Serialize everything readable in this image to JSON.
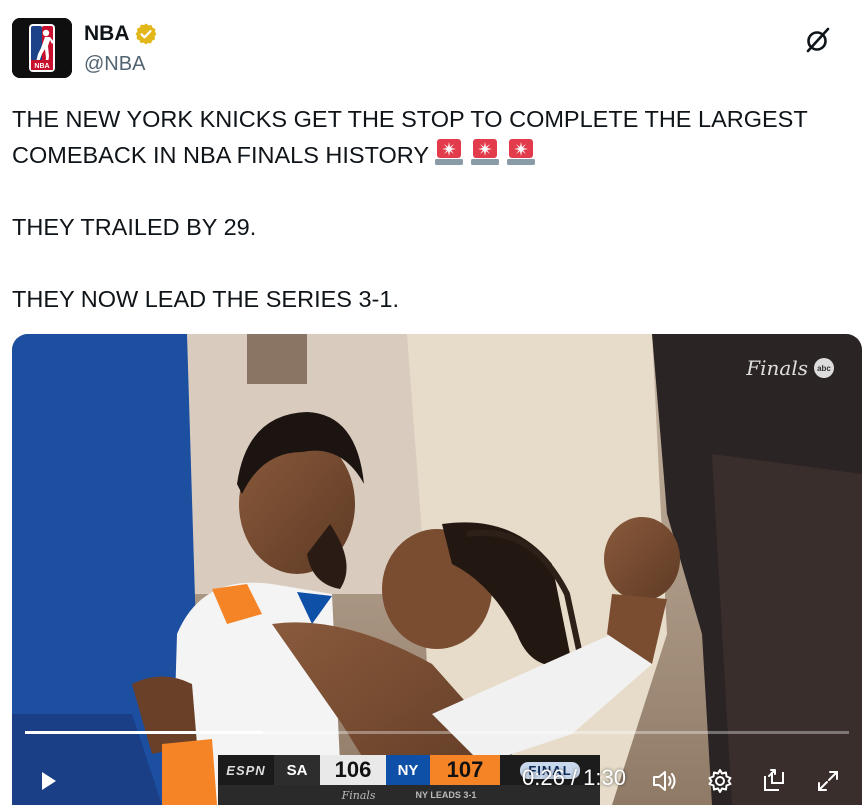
{
  "account": {
    "display_name": "NBA",
    "handle": "@NBA",
    "verified": true,
    "avatar_icon": "nba-logo-icon"
  },
  "header": {
    "x_link_icon": "x-logo-icon"
  },
  "tweet": {
    "line1": "THE NEW YORK KNICKS GET THE STOP TO COMPLETE THE LARGEST COMEBACK IN NBA FINALS HISTORY",
    "siren_emoji": [
      "🚨",
      "🚨",
      "🚨"
    ],
    "line2": "THEY TRAILED BY 29.",
    "line3": "THEY NOW LEAD THE SERIES 3-1."
  },
  "video": {
    "watermark": "Finals",
    "watermark_badge": "abc",
    "progress": 0.2889,
    "current_time": "0:26",
    "duration": "1:30",
    "time_display": "0:26 / 1:30",
    "controls": {
      "play_icon": "play-icon",
      "volume_icon": "volume-icon",
      "settings_icon": "settings-icon",
      "pip_icon": "picture-in-picture-icon",
      "fullscreen_icon": "fullscreen-icon"
    }
  },
  "scorebug": {
    "network": "ESPN",
    "team_away": "SA",
    "score_away": "106",
    "team_home": "NY",
    "score_home": "107",
    "status": "FINAL",
    "sub_logo": "Finals",
    "series_text": "NY LEADS 3-1"
  },
  "colors": {
    "text_primary": "#0f1419",
    "text_secondary": "#536471",
    "verified_gold": "#e2b719",
    "knicks_blue": "#0e4fa8",
    "knicks_orange": "#f58426"
  }
}
